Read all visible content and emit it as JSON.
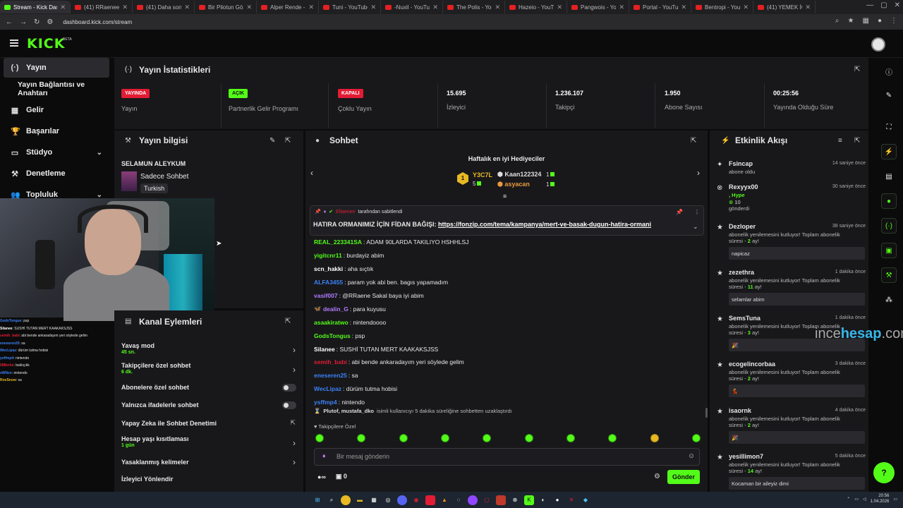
{
  "browser": {
    "tabs": [
      {
        "title": "Stream - Kick Dash",
        "type": "kick",
        "active": true
      },
      {
        "title": "(41) RRaenee İle 2 S",
        "type": "yt"
      },
      {
        "title": "(41) Daha sonra izle",
        "type": "yt"
      },
      {
        "title": "Bir Pilotun Gözünde",
        "type": "yt"
      },
      {
        "title": "Alper Rende - YouT",
        "type": "yt"
      },
      {
        "title": "Tuni - YouTube",
        "type": "yt"
      },
      {
        "title": "-Nuxil - YouTube",
        "type": "yt"
      },
      {
        "title": "The Polis - YouTube",
        "type": "yt"
      },
      {
        "title": "Hazeio - YouTube",
        "type": "yt"
      },
      {
        "title": "Pangwois - YouTube",
        "type": "yt"
      },
      {
        "title": "Portal - YouTube",
        "type": "yt"
      },
      {
        "title": "Bentropi - YouTube",
        "type": "yt"
      },
      {
        "title": "(41) YEMEK İÇİN GİT",
        "type": "yt"
      }
    ],
    "url": "dashboard.kick.com/stream"
  },
  "header": {
    "logo": "KICK",
    "beta": "BETA"
  },
  "sidebar": {
    "items": [
      {
        "label": "Yayın",
        "icon": "(·)",
        "active": true
      },
      {
        "label": "Yayın Bağlantısı ve Anahtarı",
        "icon": ""
      },
      {
        "label": "Gelir",
        "icon": "▦"
      },
      {
        "label": "Başarılar",
        "icon": "🏆"
      },
      {
        "label": "Stüdyo",
        "icon": "▭",
        "chevron": "⌄"
      },
      {
        "label": "Denetleme",
        "icon": "⚒"
      },
      {
        "label": "Topluluk",
        "icon": "👥",
        "chevron": "⌄"
      }
    ]
  },
  "stats": {
    "title": "Yayın İstatistikleri",
    "items": [
      {
        "badge": "YAYINDA",
        "badge_color": "red",
        "label": "Yayın"
      },
      {
        "badge": "AÇIK",
        "badge_color": "green",
        "label": "Partnerlik Gelir Programı"
      },
      {
        "badge": "KAPALI",
        "badge_color": "red",
        "label": "Çoklu Yayın"
      },
      {
        "value": "15.695",
        "label": "İzleyici"
      },
      {
        "value": "1.236.107",
        "label": "Takipçi"
      },
      {
        "value": "1.950",
        "label": "Abone Sayısı"
      },
      {
        "value": "00:25:56",
        "label": "Yayında Olduğu Süre"
      }
    ]
  },
  "stream_info": {
    "title": "Yayın bilgisi",
    "stream_title": "SELAMUN ALEYKUM",
    "category": "Sadece Sohbet",
    "language": "Turkish"
  },
  "overlay_chat": [
    {
      "user": "GodsTongue",
      "text": ": psp",
      "color": "#3b82f6"
    },
    {
      "user": "Silanee",
      "text": ": SUSHİ TUTAN MERT KAAKAKSJSS",
      "color": "#ffffff"
    },
    {
      "user": "semih_babi",
      "text": ": abi bende ankaradayım yeri söylede gelim",
      "color": "#e21c34"
    },
    {
      "user": "eneseren25",
      "text": ": sa",
      "color": "#3b82f6"
    },
    {
      "user": "WecLipaz",
      "text": ": dürüm tutma hobisi",
      "color": "#3b82f6"
    },
    {
      "user": "ysffmp4",
      "text": ": nintendo",
      "color": "#3b82f6"
    },
    {
      "user": "08Berke",
      "text": ": balıkçıkk",
      "color": "#e21c34"
    },
    {
      "user": "xWNzn",
      "text": ": nintendo",
      "color": "#3b82f6"
    },
    {
      "user": "RovSnow",
      "text": ": sa",
      "color": "#e8b923"
    }
  ],
  "channel_actions": {
    "title": "Kanal Eylemleri",
    "items": [
      {
        "label": "Yavaş mod",
        "sub": "45 sn.",
        "type": "arrow"
      },
      {
        "label": "Takipçilere özel sohbet",
        "sub": "6 dk.",
        "type": "arrow"
      },
      {
        "label": "Abonelere özel sohbet",
        "type": "toggle"
      },
      {
        "label": "Yalnızca ifadelerle sohbet",
        "type": "toggle"
      },
      {
        "label": "Yapay Zeka ile Sohbet Denetimi",
        "type": "external"
      },
      {
        "label": "Hesap yaşı kısıtlaması",
        "sub": "1 gün",
        "type": "arrow"
      },
      {
        "label": "Yasaklanmış kelimeler",
        "type": "arrow"
      },
      {
        "label": "İzleyici Yönlendir",
        "type": "none"
      }
    ]
  },
  "chat": {
    "title": "Sohbet",
    "gifters_title": "Haftalık en iyi Hediyeciler",
    "gifters": [
      {
        "name": "Y3C7L",
        "count": "5"
      },
      {
        "name": "Kaan122324",
        "count": "1"
      },
      {
        "name": "asyacan",
        "count": "1"
      }
    ],
    "pinned": {
      "user": "Ellaenee",
      "by": "tarafından sabitlendi",
      "text": "HATIRA ORMANIMIZ İÇİN FİDAN BAĞIŞI: ",
      "link": "https://fonzip.com/tema/kampanya/mert-ve-basak-dugun-hatira-ormani"
    },
    "messages": [
      {
        "user": "REAL_223341SA",
        "text": ": ADAM 90LARDA TAKILIYO HSHHLSJ",
        "color": "#53fc18"
      },
      {
        "user": "yigitcnr11",
        "text": ": burdayiz abim",
        "color": "#53fc18"
      },
      {
        "user": "scn_hakki",
        "text": ": aha sıçtık",
        "color": "#ffffff"
      },
      {
        "user": "ALFA3455",
        "text": ": param yok abi ben. bagıs yapamadım",
        "color": "#3b82f6"
      },
      {
        "user": "vasif007",
        "text": ": @RRaene Sakal baya iyi abim",
        "color": "#b07bff"
      },
      {
        "user": "dealin_G",
        "text": ": para kuyusu",
        "color": "#b07bff",
        "badge": "🦋"
      },
      {
        "user": "asaakiratwo",
        "text": ": nintendoooo",
        "color": "#53fc18"
      },
      {
        "user": "GodsTongus",
        "text": ": psp",
        "color": "#53fc18"
      },
      {
        "user": "Silanee",
        "text": ": SUSHİ TUTAN MERT KAAKAKSJSS",
        "color": "#ffffff"
      },
      {
        "user": "semih_babi",
        "text": ": abi bende ankaradayım yeri söylede gelim",
        "color": "#e21c34"
      },
      {
        "user": "eneseren25",
        "text": ": sa",
        "color": "#3b82f6"
      },
      {
        "user": "WecLipaz",
        "text": ": dürüm tutma hobisi",
        "color": "#3b82f6"
      },
      {
        "user": "ysffmp4",
        "text": ": nintendo",
        "color": "#3b82f6"
      }
    ],
    "system_msg_user": "Plutof, mustafa_dko",
    "system_msg": "isimli kullanıcıyı 5 dakika süreliğine sohbetten uzaklaştırdı",
    "emote_label": "Takipçilere Özel",
    "input_placeholder": "Bir mesaj gönderin",
    "viewer_icon": "∞",
    "count": "0",
    "send": "Gönder"
  },
  "activity": {
    "title": "Etkinlik Akışı",
    "events": [
      {
        "name": "Fsincap",
        "time": "14 saniye önce",
        "desc": "abone oldu",
        "icon": "✦"
      },
      {
        "name": "Rexyyx00",
        "time": "30 saniye önce",
        "desc": ", Hype",
        "extra": "10",
        "extra2": "gönderdi",
        "icon": "⊗"
      },
      {
        "name": "Dezloper",
        "time": "38 saniye önce",
        "desc": "abonelik yenilemesini kutluyor! Toplam abonelik süresi -",
        "months": "2",
        "unit": "ay!",
        "note": "napicaz",
        "icon": "★"
      },
      {
        "name": "zezethra",
        "time": "1 dakika önce",
        "desc": "abonelik yenilemesini kutluyor! Toplam abonelik süresi -",
        "months": "11",
        "unit": "ay!",
        "note": "selamlar abim",
        "icon": "★"
      },
      {
        "name": "SemsTuna",
        "time": "1 dakika önce",
        "desc": "abonelik yenilemesini kutluyor! Toplam abonelik süresi -",
        "months": "3",
        "unit": "ay!",
        "note": "🎉",
        "icon": "★"
      },
      {
        "name": "ecogelincorbaa",
        "time": "3 dakika önce",
        "desc": "abonelik yenilemesini kutluyor! Toplam abonelik süresi -",
        "months": "2",
        "unit": "ay!",
        "note": "💃",
        "icon": "★"
      },
      {
        "name": "isaornk",
        "time": "4 dakika önce",
        "desc": "abonelik yenilemesini kutluyor! Toplam abonelik süresi -",
        "months": "2",
        "unit": "ay!",
        "note": "🎉",
        "icon": "★"
      },
      {
        "name": "yesillimon7",
        "time": "5 dakika önce",
        "desc": "abonelik yenilemesini kutluyor! Toplam abonelik süresi -",
        "months": "14",
        "unit": "ay!",
        "note": "Kocaman bir aileyiz dimi",
        "icon": "★"
      }
    ]
  },
  "watermark": {
    "a": "ince",
    "b": "hesap",
    "c": ".com"
  },
  "taskbar": {
    "time": "20:56",
    "date": "1.04.2026"
  }
}
